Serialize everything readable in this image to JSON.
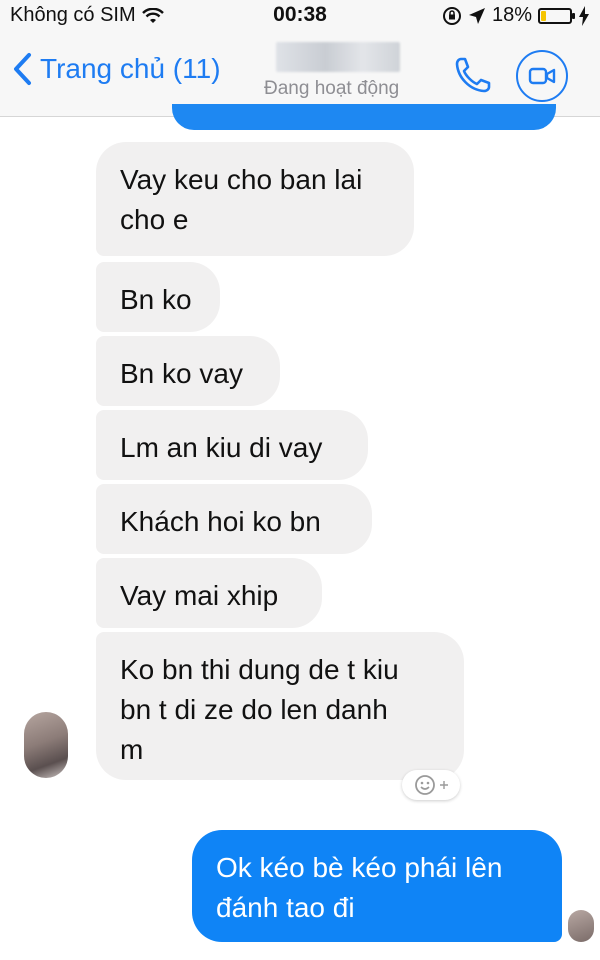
{
  "status_bar": {
    "carrier": "Không có SIM",
    "time": "00:38",
    "battery": "18%",
    "battery_level": 0.18,
    "icons": [
      "wifi-icon",
      "orientation-lock-icon",
      "location-arrow-icon",
      "battery-icon",
      "charging-bolt-icon"
    ]
  },
  "nav": {
    "back_label": "Trang chủ (11)",
    "contact_status": "Đang hoạt động",
    "accent_color": "#1e7cf2"
  },
  "messages": {
    "incoming": [
      {
        "text": "Vay keu cho ban lai\ncho e"
      },
      {
        "text": "Bn ko"
      },
      {
        "text": "Bn ko vay"
      },
      {
        "text": "Lm an kiu di vay"
      },
      {
        "text": "Khách hoi ko bn"
      },
      {
        "text": "Vay mai xhip"
      },
      {
        "text": "Ko bn thi dung de t kiu\nbn t di ze do len danh\nm"
      }
    ],
    "outgoing": [
      {
        "text": "Ok kéo bè kéo phái lên\nđánh tao đi"
      }
    ]
  },
  "colors": {
    "incoming_bubble": "#f1f0f0",
    "outgoing_bubble": "#0f84f6"
  }
}
